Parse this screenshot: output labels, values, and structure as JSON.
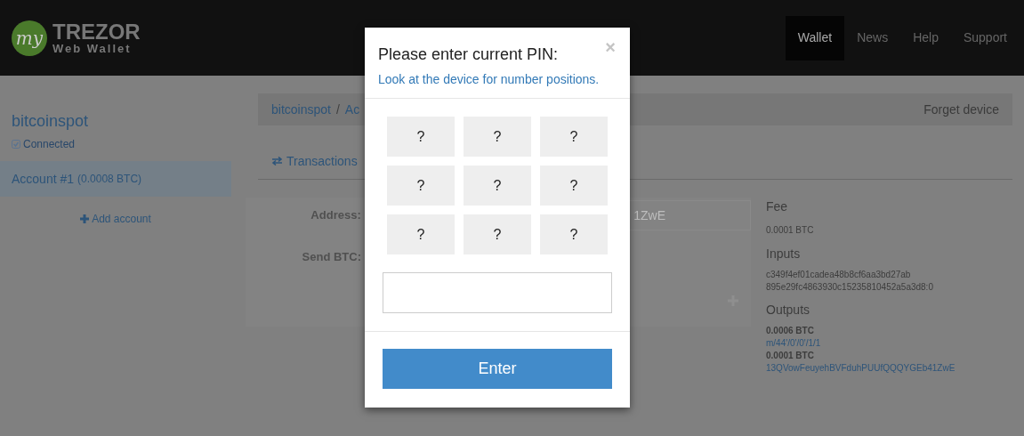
{
  "header": {
    "logo_mark": "my",
    "logo_title": "TREZOR",
    "logo_subtitle": "Web Wallet",
    "nav": [
      {
        "label": "Wallet",
        "selected": true
      },
      {
        "label": "News",
        "selected": false
      },
      {
        "label": "Help",
        "selected": false
      },
      {
        "label": "Support",
        "selected": false
      }
    ]
  },
  "sidebar": {
    "device": "bitcoinspot",
    "status": "Connected",
    "accounts": [
      {
        "name": "Account #1",
        "balance": "(0.0008 BTC)",
        "selected": true
      }
    ],
    "add_account": "Add account"
  },
  "breadcrumb": {
    "items": [
      "bitcoinspot",
      "Ac"
    ],
    "separator": "/"
  },
  "forget_device": "Forget device",
  "tabs": [
    {
      "label": "Transactions",
      "selected": true
    }
  ],
  "form": {
    "address_label": "Address:",
    "address_value": "1ZwE",
    "send_label": "Send BTC:"
  },
  "summary": {
    "fee_title": "Fee",
    "fee": "0.0001 BTC",
    "inputs_title": "Inputs",
    "inputs": [
      "c349f4ef01cadea48b8cf6aa3bd27ab",
      "895e29fc4863930c15235810452a5a3d8:0"
    ],
    "outputs_title": "Outputs",
    "outputs": [
      {
        "amount": "0.0006 BTC",
        "address": "m/44'/0'/0'/1/1"
      },
      {
        "amount": "0.0001 BTC",
        "address": "13QVowFeuyehBVFduhPUUfQQQYGEb41ZwE"
      }
    ]
  },
  "modal": {
    "title": "Please enter current PIN:",
    "close": "×",
    "subtitle": "Look at the device for number positions.",
    "keys": [
      "?",
      "?",
      "?",
      "?",
      "?",
      "?",
      "?",
      "?",
      "?"
    ],
    "button": "Enter"
  }
}
